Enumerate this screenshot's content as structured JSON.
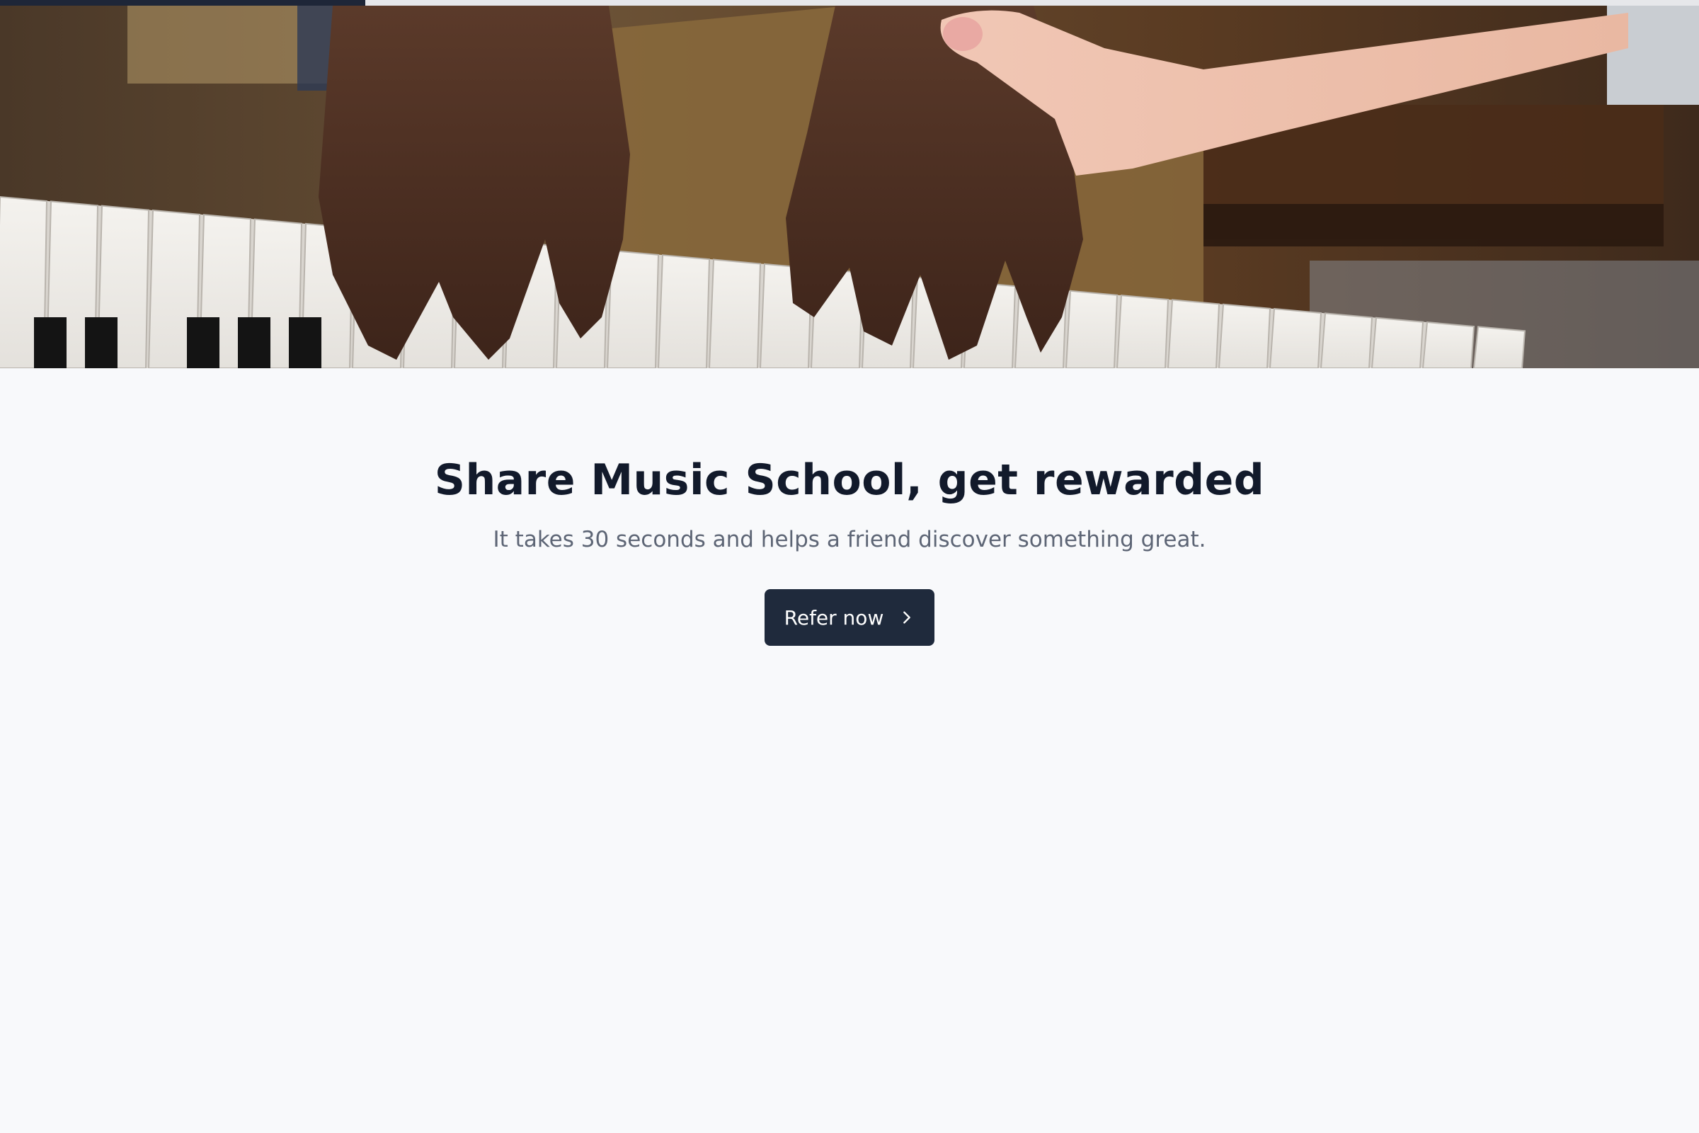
{
  "progress": {
    "fraction": 0.215
  },
  "hero": {
    "image": "piano-lesson-photo",
    "alt_icon": "hands-on-piano-keys-image"
  },
  "headline": "Share Music School, get rewarded",
  "subtitle": "It takes 30 seconds and helps a friend discover something great.",
  "cta": {
    "label": "Refer now",
    "icon": "chevron-right-icon"
  },
  "colors": {
    "background": "#f8f9fb",
    "headline": "#121a2b",
    "subtitle": "#5d6575",
    "button": "#1f2a3c",
    "progress_fill": "#1e2638",
    "progress_track": "#e6e7ea"
  }
}
